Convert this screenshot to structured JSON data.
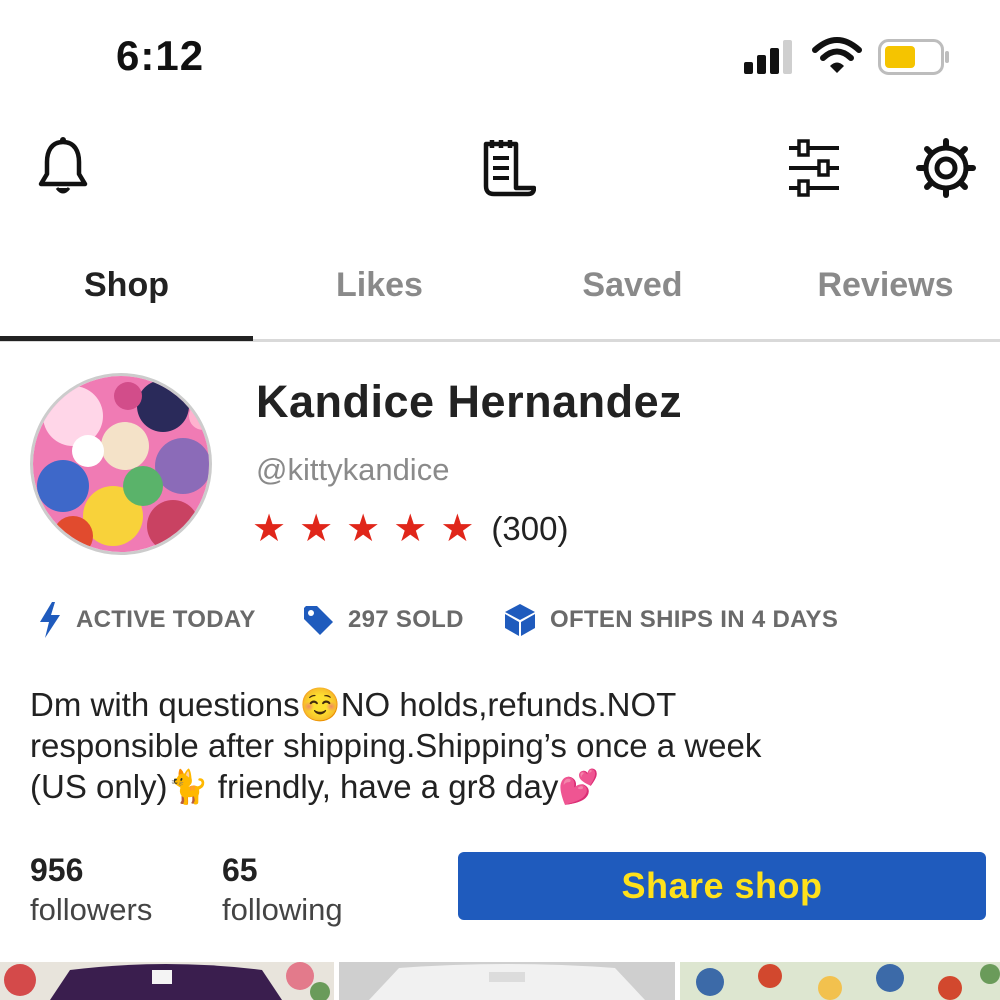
{
  "status_bar": {
    "time": "6:12",
    "icons": [
      "signal-icon",
      "wifi-icon",
      "battery-icon"
    ],
    "battery_color": "#f5c400"
  },
  "top_nav": {
    "icons": [
      "bell-icon",
      "receipt-icon",
      "sliders-icon",
      "gear-icon"
    ]
  },
  "tabs": [
    {
      "label": "Shop",
      "active": true
    },
    {
      "label": "Likes",
      "active": false
    },
    {
      "label": "Saved",
      "active": false
    },
    {
      "label": "Reviews",
      "active": false
    }
  ],
  "profile": {
    "name": "Kandice Hernandez",
    "handle": "@kittykandice",
    "rating_stars": 5,
    "rating_count": "(300)",
    "star_color": "#e0261a"
  },
  "badges": [
    {
      "icon": "lightning-icon",
      "label": "ACTIVE TODAY"
    },
    {
      "icon": "tag-icon",
      "label": "297 SOLD"
    },
    {
      "icon": "box-icon",
      "label": "OFTEN SHIPS IN 4 DAYS"
    }
  ],
  "badge_icon_color": "#1f5bbd",
  "bio": {
    "line1": "Dm with questions☺️NO holds,refunds.NOT",
    "line2": "responsible after shipping.Shipping’s once a week",
    "line3": "(US only)🐈 friendly, have a gr8 day💕"
  },
  "stats": {
    "followers_count": "956",
    "followers_label": "followers",
    "following_count": "65",
    "following_label": "following"
  },
  "share_button": {
    "label": "Share shop",
    "bg_color": "#1f5bbd",
    "text_color": "#ffe11a"
  }
}
